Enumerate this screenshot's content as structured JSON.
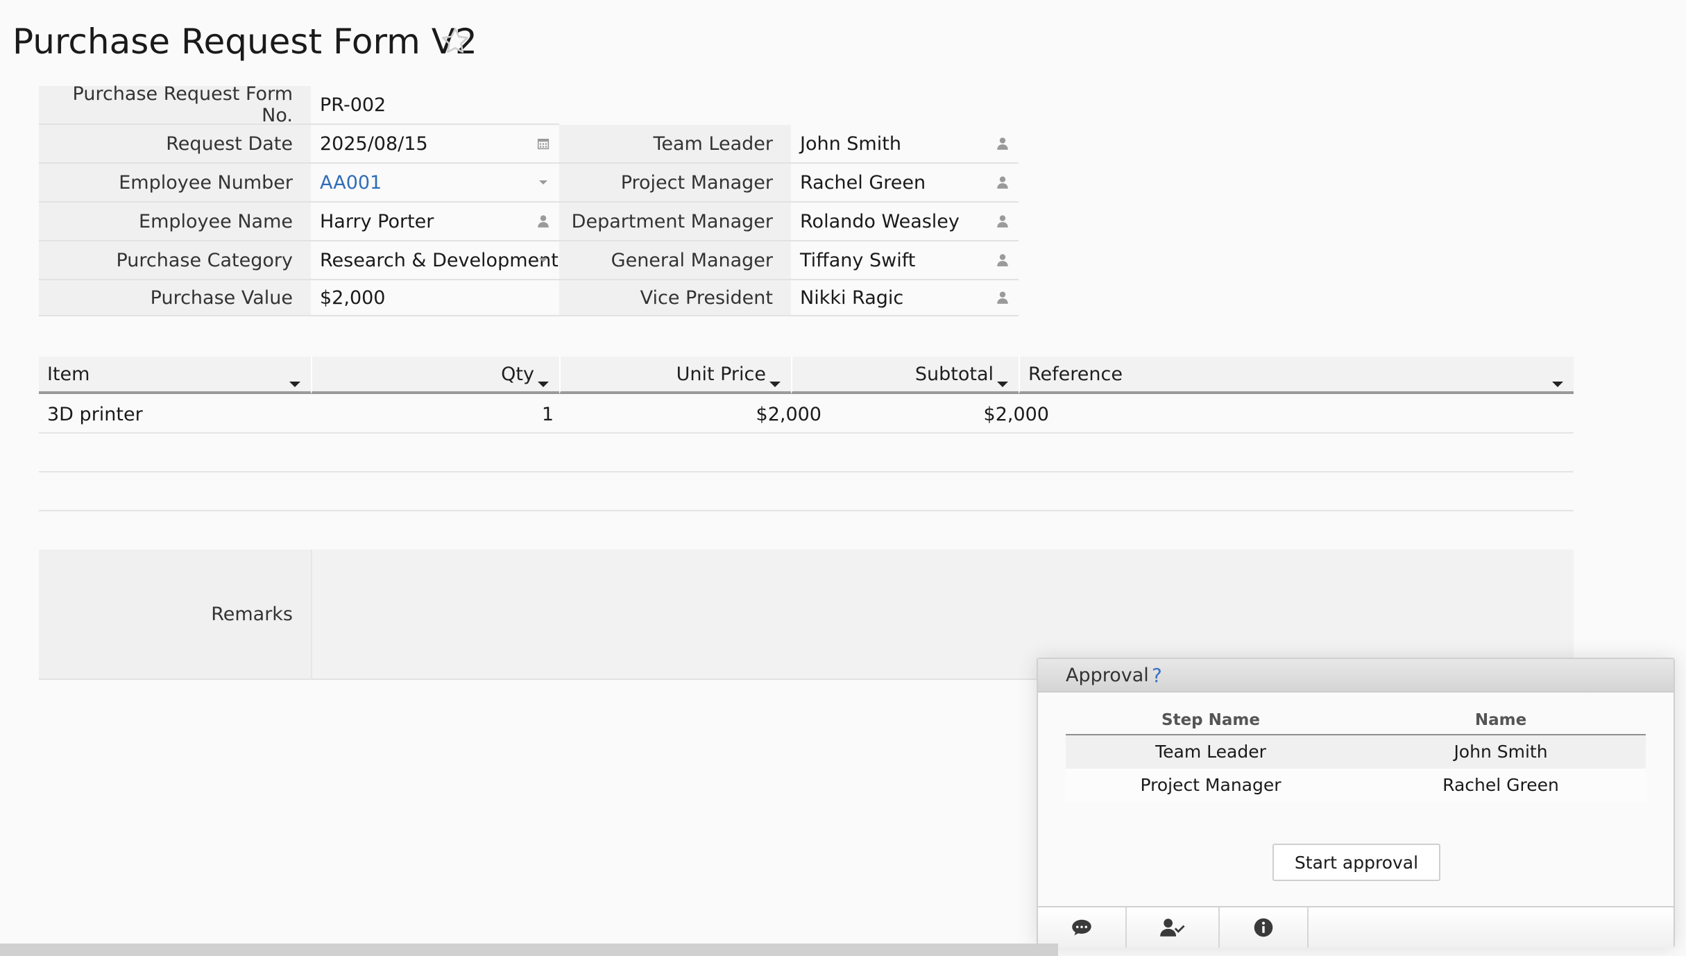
{
  "page": {
    "title": "Purchase Request Form V2",
    "favorite_icon": "star-outline-icon"
  },
  "form": {
    "form_no": {
      "label": "Purchase Request Form No.",
      "value": "PR-002"
    },
    "left": [
      {
        "label": "Request Date",
        "value": "2025/08/15",
        "icon": "calendar-icon"
      },
      {
        "label": "Employee Number",
        "value": "AA001",
        "icon": "dropdown-arrow-icon"
      },
      {
        "label": "Employee Name",
        "value": "Harry Porter",
        "icon": "person-icon"
      },
      {
        "label": "Purchase Category",
        "value": "Research & Development",
        "icon": "dropdown-arrow-icon"
      },
      {
        "label": "Purchase Value",
        "value": "$2,000"
      }
    ],
    "right": [
      {
        "label": "Team Leader",
        "value": "John Smith",
        "icon": "person-icon"
      },
      {
        "label": "Project Manager",
        "value": "Rachel Green",
        "icon": "person-icon"
      },
      {
        "label": "Department Manager",
        "value": "Rolando Weasley",
        "icon": "person-icon"
      },
      {
        "label": "General Manager",
        "value": "Tiffany Swift",
        "icon": "person-icon"
      },
      {
        "label": "Vice President",
        "value": "Nikki Ragic",
        "icon": "person-icon"
      }
    ],
    "remarks_label": "Remarks",
    "remarks_value": ""
  },
  "items_table": {
    "columns": [
      "Item",
      "Qty",
      "Unit Price",
      "Subtotal",
      "Reference"
    ],
    "rows": [
      {
        "item": "3D printer",
        "qty": "1",
        "unit_price": "$2,000",
        "subtotal": "$2,000",
        "reference": ""
      }
    ]
  },
  "approval": {
    "title": "Approval",
    "help": "?",
    "columns": [
      "Step Name",
      "Name"
    ],
    "steps": [
      {
        "step": "Team Leader",
        "name": "John Smith"
      },
      {
        "step": "Project Manager",
        "name": "Rachel Green"
      }
    ],
    "start_button": "Start approval",
    "footer_icons": [
      "comment-icon",
      "user-check-icon",
      "info-icon"
    ]
  }
}
